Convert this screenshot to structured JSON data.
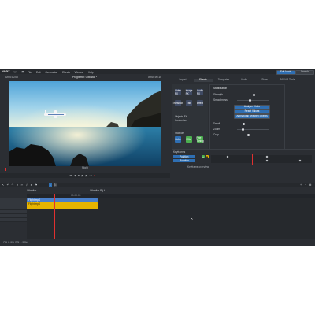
{
  "app": {
    "logo": "MAGIX",
    "menu": [
      "File",
      "Edit",
      "Generation",
      "Effects",
      "Window",
      "Help"
    ],
    "top_right": {
      "primary": "Edit Mode",
      "secondary": "Search"
    }
  },
  "preview": {
    "timecode_left": "00:00:00.00",
    "title": "Programm: Gibraltar *",
    "timecode_right": "00:00:09.15",
    "scrubber_label": "Flight"
  },
  "media_tabs": [
    "Import",
    "Effects",
    "Templates",
    "Audio",
    "Store",
    "360/VR Tools"
  ],
  "effects_panel": {
    "tiles": [
      "Video FX",
      "Image FX",
      "Audio FX",
      "Transition",
      "Title",
      "Effect",
      "Color",
      "Filter",
      "Fine Tuning"
    ],
    "section_labels": [
      "Objects FX",
      "Customize",
      "Stabilize"
    ],
    "settings_title": "Stabilization",
    "settings_rows": [
      {
        "label": "Strength",
        "value": 55
      },
      {
        "label": "Smoothness",
        "value": 40
      },
      {
        "label": "Detail",
        "value": 20
      },
      {
        "label": "Zoom",
        "value": 15
      },
      {
        "label": "Crop",
        "value": 35
      }
    ],
    "buttons": [
      "Analyze Video",
      "Reset Values",
      "Apply to all selected objects"
    ]
  },
  "keyframe_panel": {
    "title": "Keyframes",
    "tracks": [
      "Position",
      "Rotation"
    ],
    "tab_label": "Keyframe overview"
  },
  "timeline": {
    "tab_left": "Gibraltar",
    "tab_right": "Gibraltar Prj *",
    "ruler_label": "00:00:05",
    "video_clip_label": "Flight.mp4",
    "audio_clip_label": "Flight.mp4"
  },
  "status": {
    "text": "CPU : 9%   GPU : 52%"
  },
  "colors": {
    "accent": "#2f6fb3",
    "video_clip": "#4a7fc9",
    "audio_clip": "#e6b400",
    "playhead": "#e03030"
  }
}
